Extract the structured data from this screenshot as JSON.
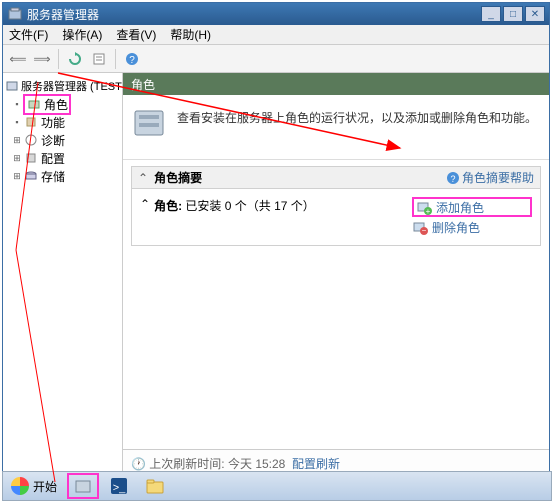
{
  "window": {
    "title": "服务器管理器",
    "menu": {
      "file": "文件(F)",
      "action": "操作(A)",
      "view": "查看(V)",
      "help": "帮助(H)"
    },
    "buttons": {
      "min": "_",
      "max": "□",
      "close": "✕"
    }
  },
  "tree": {
    "root": "服务器管理器 (TEST-ZHUAD)",
    "roles": "角色",
    "features": "功能",
    "diagnostics": "诊断",
    "config": "配置",
    "storage": "存储"
  },
  "content": {
    "header": "角色",
    "banner_text": "查看安装在服务器上角色的运行状况，以及添加或删除角色和功能。",
    "summary_title": "角色摘要",
    "summary_help": "角色摘要帮助",
    "roles_label": "角色:",
    "roles_status": "已安装 0 个（共 17 个）",
    "add_role": "添加角色",
    "remove_role": "删除角色"
  },
  "statusbar": {
    "last_refresh_label": "上次刷新时间:",
    "last_refresh_time": "今天 15:28",
    "refresh_link": "配置刷新"
  },
  "taskbar": {
    "start": "开始"
  }
}
